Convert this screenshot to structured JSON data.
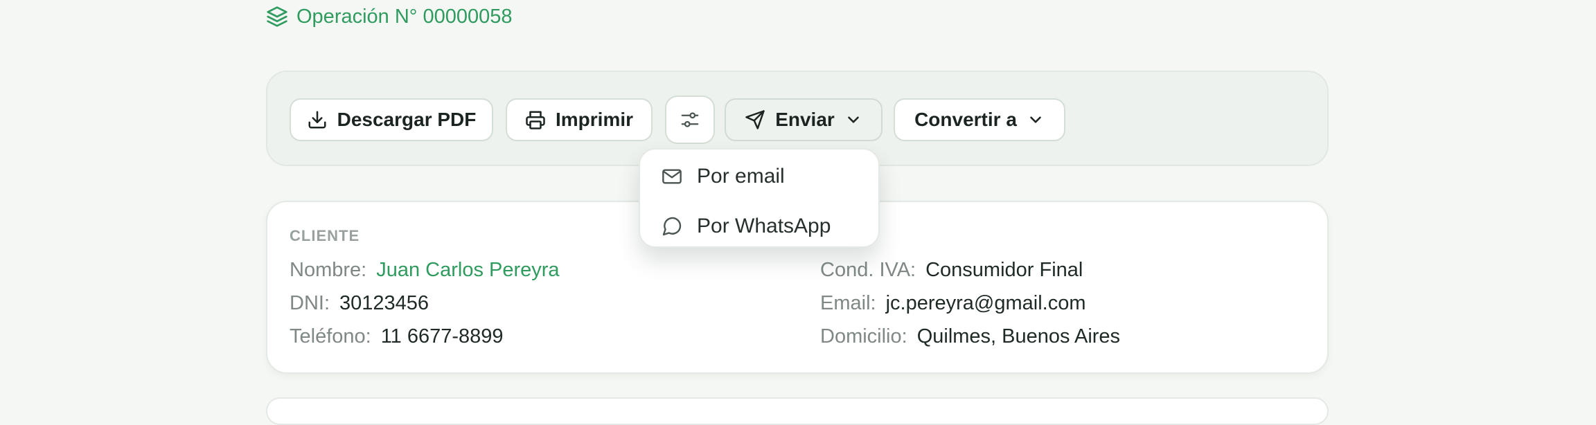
{
  "header": {
    "operation_title": "Operación N° 00000058"
  },
  "toolbar": {
    "download_label": "Descargar PDF",
    "print_label": "Imprimir",
    "send_label": "Enviar",
    "convert_label": "Convertir a"
  },
  "send_menu": {
    "items": [
      {
        "label": "Por email",
        "icon": "mail-icon"
      },
      {
        "label": "Por WhatsApp",
        "icon": "chat-bubble-icon"
      }
    ]
  },
  "client": {
    "section_title": "CLIENTE",
    "name_label": "Nombre:",
    "name_value": "Juan Carlos Pereyra",
    "dni_label": "DNI:",
    "dni_value": "30123456",
    "phone_label": "Teléfono:",
    "phone_value": "11 6677-8899",
    "iva_label": "Cond. IVA:",
    "iva_value": "Consumidor Final",
    "email_label": "Email:",
    "email_value": "jc.pereyra@gmail.com",
    "address_label": "Domicilio:",
    "address_value": "Quilmes, Buenos Aires"
  },
  "colors": {
    "accent": "#2f9b5f",
    "background": "#f5f7f4",
    "muted_text": "#7f8883"
  }
}
